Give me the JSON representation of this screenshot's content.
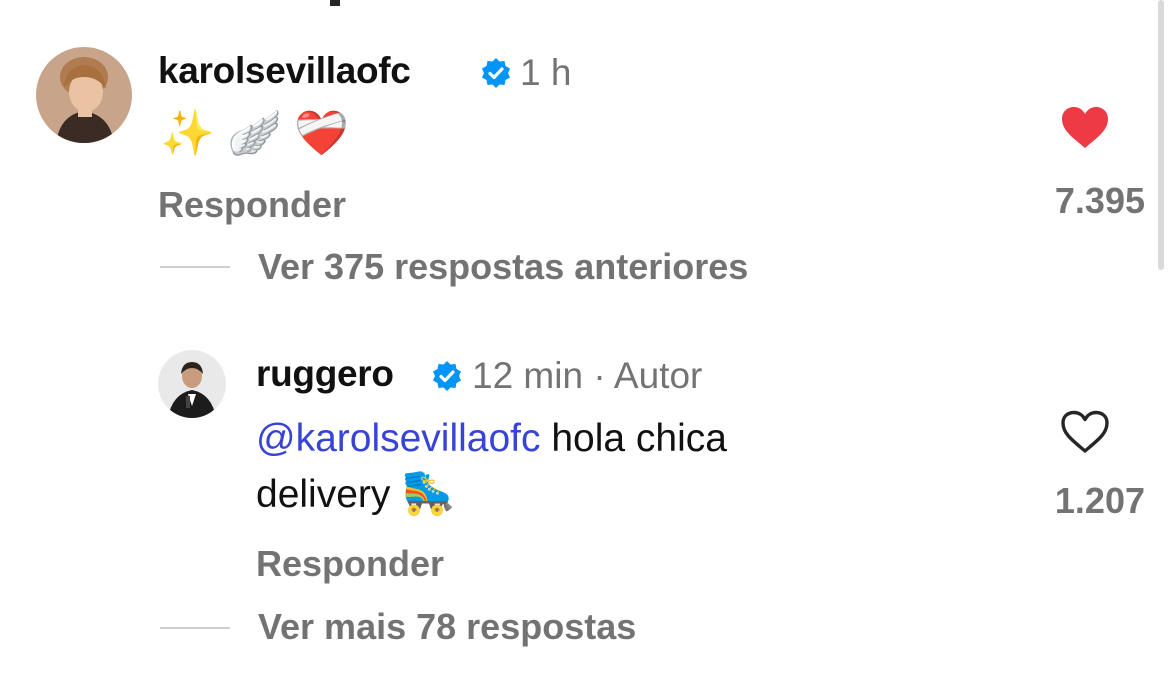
{
  "comments": [
    {
      "username": "karolsevillaofc",
      "verified": true,
      "time": "1 h",
      "text_emoji": "✨ 🪽 ❤️‍🩹",
      "reply_label": "Responder",
      "likes": "7.395",
      "liked": true,
      "thread_link": "Ver 375 respostas anteriores"
    },
    {
      "username": "ruggero",
      "verified": true,
      "time": "12 min",
      "separator": "·",
      "author_label": "Autor",
      "mention": "@karolsevillaofc",
      "text_line1": " hola chica",
      "text_line2": "delivery",
      "text_emoji": "🛼",
      "reply_label": "Responder",
      "likes": "1.207",
      "liked": false,
      "thread_link": "Ver mais 78 respostas"
    }
  ],
  "colors": {
    "verified": "#0095f6",
    "liked_heart": "#ed3a45",
    "secondary_text": "#737373",
    "mention": "#3845d4"
  }
}
